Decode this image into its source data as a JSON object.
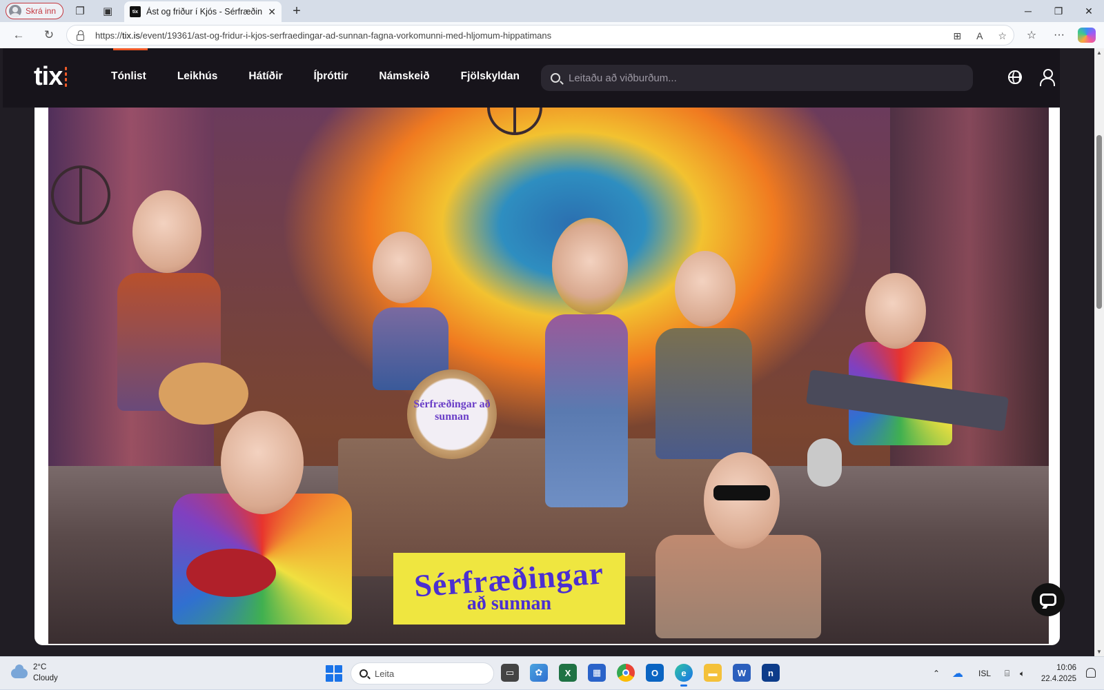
{
  "browser": {
    "profile_label": "Skrá inn",
    "tab_title": "Ást og friður í Kjós - Sérfræðingar",
    "tab_favicon_text": "tix",
    "url_prefix": "https://",
    "url_domain": "tix.is",
    "url_path": "/event/19361/ast-og-fridur-i-kjos-serfraedingar-ad-sunnan-fagna-vorkomunni-med-hljomum-hippatimans"
  },
  "site": {
    "logo": "tix",
    "accent_color": "#f05a28",
    "nav": [
      "Tónlist",
      "Leikhús",
      "Hátíðir",
      "Íþróttir",
      "Námskeið",
      "Fjölskyldan"
    ],
    "search_placeholder": "Leitaðu að viðburðum..."
  },
  "poster": {
    "drum_text": "Sérfræðingar að sunnan",
    "banner_line1": "Sérfræðingar",
    "banner_line2": "að sunnan"
  },
  "taskbar": {
    "weather_temp": "2°C",
    "weather_desc": "Cloudy",
    "search_placeholder": "Leita",
    "language": "ISL",
    "time": "10:06",
    "date": "22.4.2025"
  }
}
